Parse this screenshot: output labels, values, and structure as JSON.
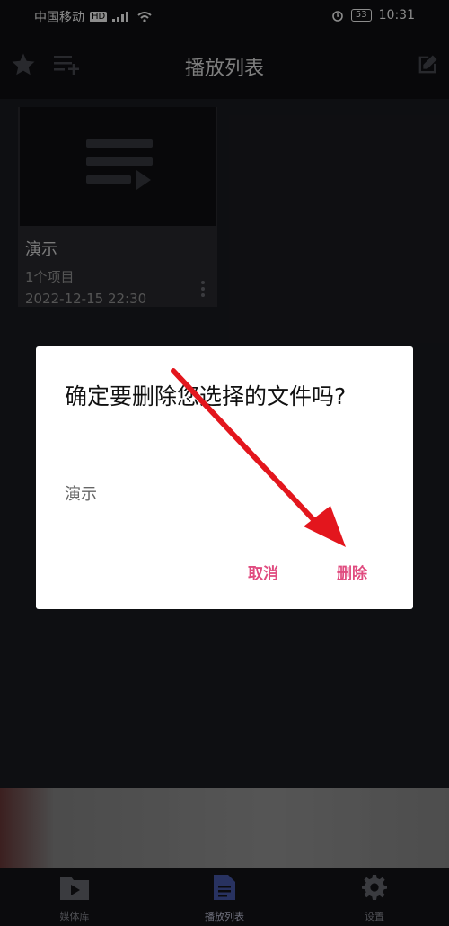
{
  "status_bar": {
    "carrier": "中国移动",
    "hd": "HD",
    "battery": "53",
    "time": "10:31"
  },
  "app_bar": {
    "title": "播放列表"
  },
  "playlist": {
    "items": [
      {
        "title": "演示",
        "count": "1个项目",
        "date": "2022-12-15 22:30"
      }
    ]
  },
  "dialog": {
    "title": "确定要删除您选择的文件吗?",
    "message": "演示",
    "cancel_label": "取消",
    "delete_label": "删除"
  },
  "bottom_nav": {
    "items": [
      {
        "label": "媒体库"
      },
      {
        "label": "播放列表"
      },
      {
        "label": "设置"
      }
    ]
  },
  "colors": {
    "accent": "#e04b7f",
    "arrow": "#e3161d",
    "nav_active": "#4a5bb0"
  }
}
